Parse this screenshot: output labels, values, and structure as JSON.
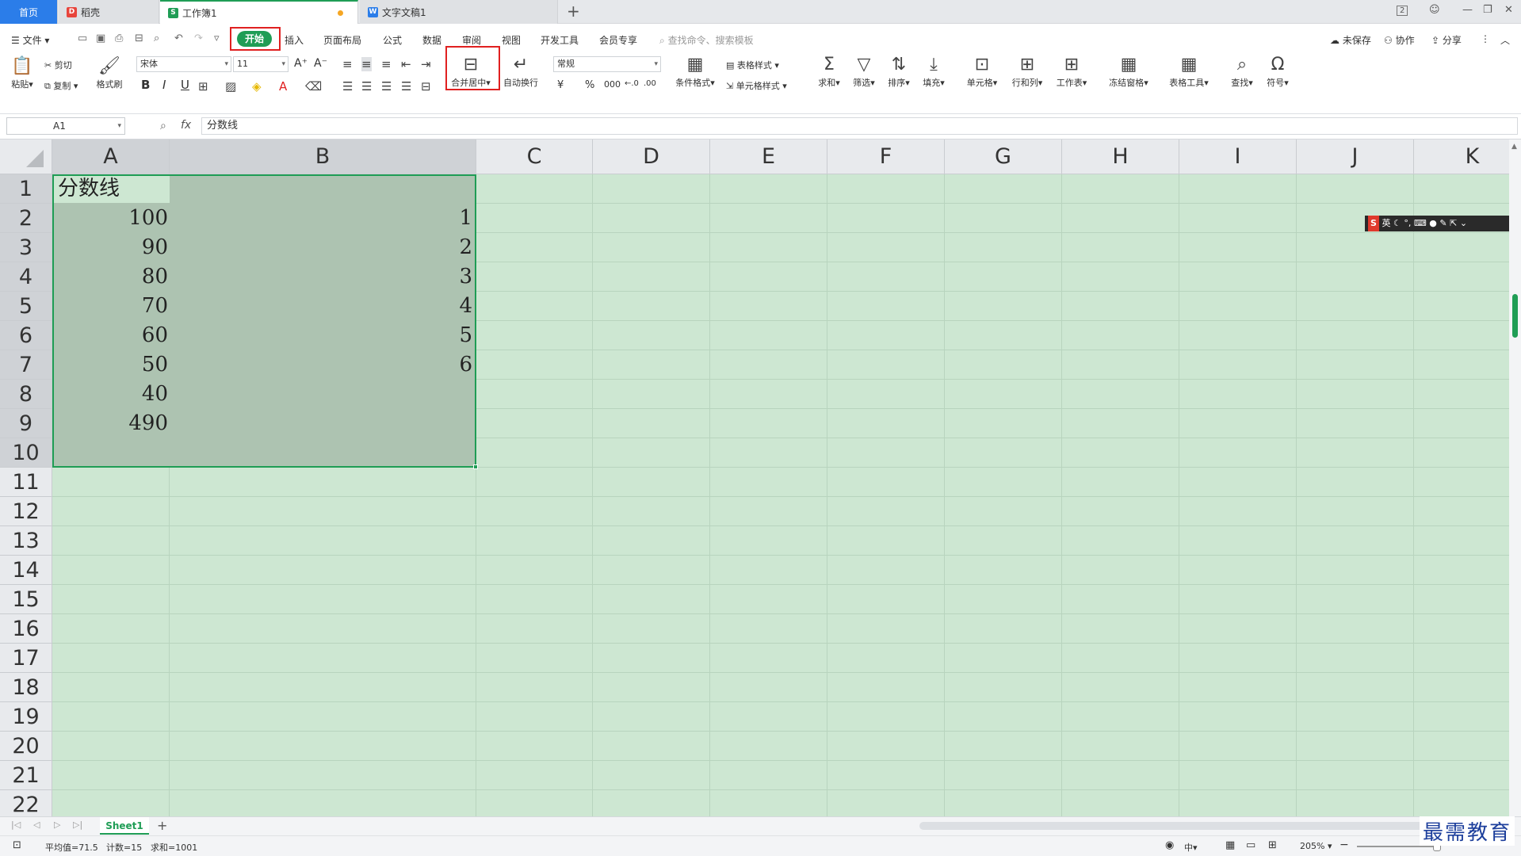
{
  "tabs": {
    "home": "首页",
    "daoke": "稻壳",
    "workbook": "工作簿1",
    "doc": "文字文稿1",
    "new_tab": "+"
  },
  "window": {
    "badge": "2"
  },
  "menu": {
    "file": "文件",
    "start": "开始",
    "items": [
      "插入",
      "页面布局",
      "公式",
      "数据",
      "审阅",
      "视图",
      "开发工具",
      "会员专享"
    ],
    "search_placeholder": "查找命令、搜索模板",
    "unsaved": "未保存",
    "collab": "协作",
    "share": "分享"
  },
  "ribbon": {
    "paste": "粘贴",
    "cut": "剪切",
    "copy": "复制",
    "format_painter": "格式刷",
    "font_name": "宋体",
    "font_size": "11",
    "bold": "B",
    "italic": "I",
    "underline": "U",
    "merge_center": "合并居中",
    "wrap_text": "自动换行",
    "number_format": "常规",
    "currency": "¥",
    "percent": "%",
    "thousands": "000",
    "cond_format": "条件格式",
    "table_style": "表格样式",
    "cell_style": "单元格样式",
    "sum": "求和",
    "filter": "筛选",
    "sort": "排序",
    "fill": "填充",
    "cells": "单元格",
    "rows_cols": "行和列",
    "worksheet": "工作表",
    "freeze": "冻结窗格",
    "table_tools": "表格工具",
    "find": "查找",
    "symbol": "符号"
  },
  "formula": {
    "name_box": "A1",
    "fx": "fx",
    "content": "分数线"
  },
  "columns": [
    "A",
    "B",
    "C",
    "D",
    "E",
    "F",
    "G",
    "H",
    "I",
    "J",
    "K"
  ],
  "rows": [
    "1",
    "2",
    "3",
    "4",
    "5",
    "6",
    "7",
    "8",
    "9",
    "10",
    "11",
    "12",
    "13",
    "14",
    "15",
    "16",
    "17",
    "18",
    "19",
    "20",
    "21",
    "22"
  ],
  "cells": {
    "A1": "分数线",
    "A": [
      "100",
      "90",
      "80",
      "70",
      "60",
      "50",
      "40",
      "490"
    ],
    "B": [
      "1",
      "2",
      "3",
      "4",
      "5",
      "6"
    ]
  },
  "ime": {
    "logo": "S",
    "lang": "英"
  },
  "sheets": {
    "active": "Sheet1",
    "add": "+"
  },
  "status": {
    "average": "平均值=71.5",
    "count": "计数=15",
    "sum": "求和=1001",
    "zoom": "205%"
  },
  "watermark": "最需教育",
  "colors": {
    "accent": "#1f9d55",
    "selection": "#adc3b1",
    "grid_bg": "#cde7d2",
    "highlight": "#e02020"
  }
}
